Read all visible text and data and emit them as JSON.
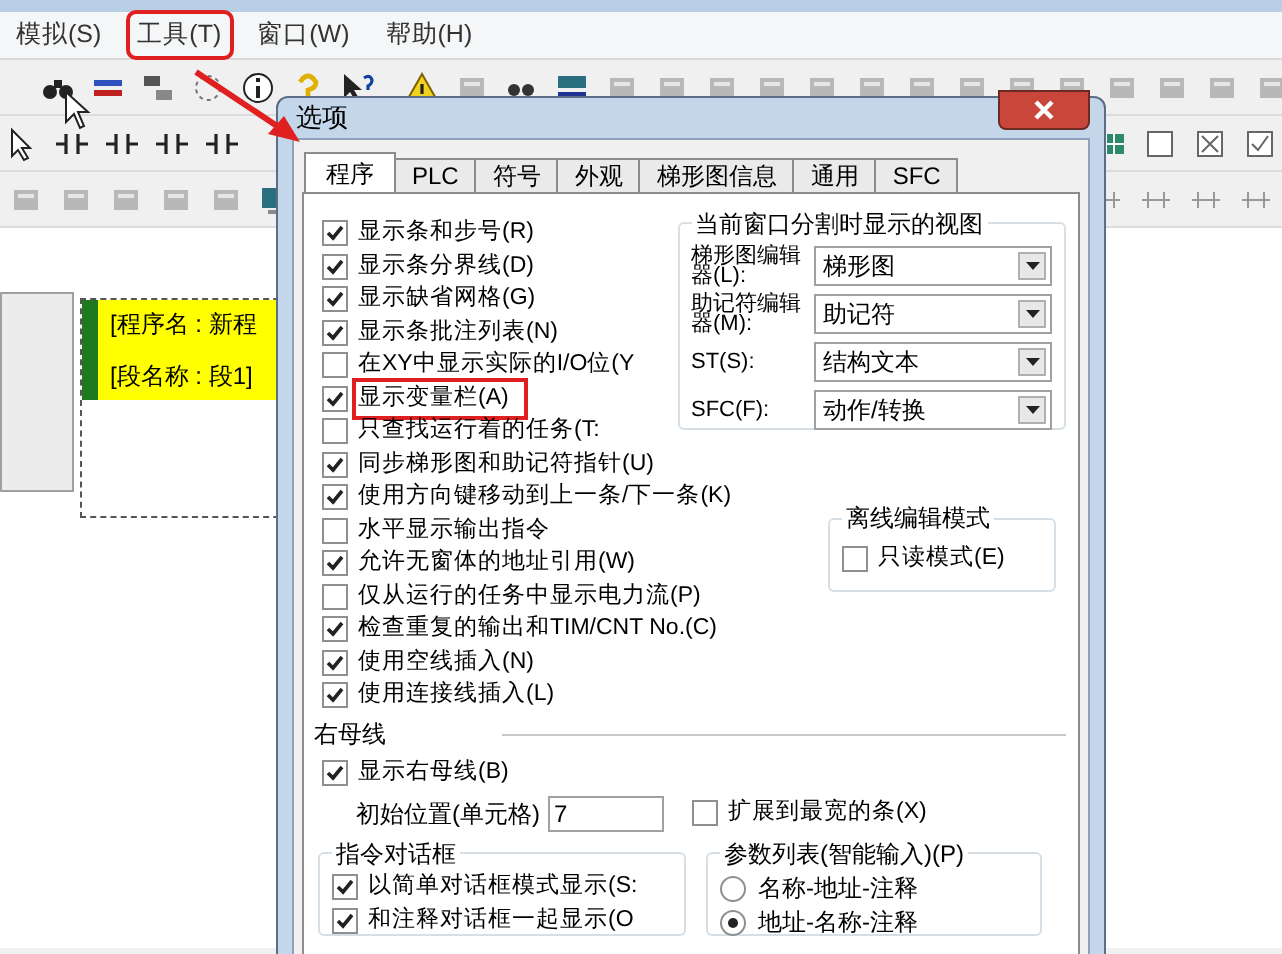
{
  "menu": [
    {
      "label": "模拟(S)",
      "highlighted": false
    },
    {
      "label": "工具(T)",
      "highlighted": true
    },
    {
      "label": "窗口(W)",
      "highlighted": false
    },
    {
      "label": "帮助(H)",
      "highlighted": false
    }
  ],
  "document": {
    "lines": [
      "[程序名 : 新程",
      "[段名称 : 段1]"
    ]
  },
  "dialog": {
    "title": "选项",
    "tabs": [
      {
        "label": "程序",
        "selected": true
      },
      {
        "label": "PLC",
        "selected": false
      },
      {
        "label": "符号",
        "selected": false
      },
      {
        "label": "外观",
        "selected": false
      },
      {
        "label": "梯形图信息",
        "selected": false
      },
      {
        "label": "通用",
        "selected": false
      },
      {
        "label": "SFC",
        "selected": false
      }
    ],
    "options": [
      {
        "label": "显示条和步号(R)",
        "checked": true,
        "highlighted": false
      },
      {
        "label": "显示条分界线(D)",
        "checked": true,
        "highlighted": false
      },
      {
        "label": "显示缺省网格(G)",
        "checked": true,
        "highlighted": false
      },
      {
        "label": "显示条批注列表(N)",
        "checked": true,
        "highlighted": false
      },
      {
        "label": "在XY中显示实际的I/O位(Y",
        "checked": false,
        "highlighted": false
      },
      {
        "label": "显示变量栏(A)",
        "checked": true,
        "highlighted": true
      },
      {
        "label": "只查找运行着的任务(T:",
        "checked": false,
        "highlighted": false
      },
      {
        "label": "同步梯形图和助记符指针(U)",
        "checked": true,
        "highlighted": false
      },
      {
        "label": "使用方向键移动到上一条/下一条(K)",
        "checked": true,
        "highlighted": false
      },
      {
        "label": "水平显示输出指令",
        "checked": false,
        "highlighted": false
      },
      {
        "label": "允许无窗体的地址引用(W)",
        "checked": true,
        "highlighted": false
      },
      {
        "label": "仅从运行的任务中显示电力流(P)",
        "checked": false,
        "highlighted": false
      },
      {
        "label": "检查重复的输出和TIM/CNT No.(C)",
        "checked": true,
        "highlighted": false
      },
      {
        "label": "使用空线插入(N)",
        "checked": true,
        "highlighted": false
      },
      {
        "label": "使用连接线插入(L)",
        "checked": true,
        "highlighted": false
      }
    ],
    "view_group": {
      "title": "当前窗口分割时显示的视图",
      "rows": [
        {
          "label": "梯形图编辑器(L):",
          "value": "梯形图"
        },
        {
          "label": "助记符编辑器(M):",
          "value": "助记符"
        },
        {
          "label": "ST(S):",
          "value": "结构文本"
        },
        {
          "label": "SFC(F):",
          "value": "动作/转换"
        }
      ]
    },
    "offline_group": {
      "title": "离线编辑模式",
      "options": [
        {
          "label": "只读模式(E)",
          "checked": false
        }
      ]
    },
    "right_bus": {
      "title": "右母线",
      "show": {
        "label": "显示右母线(B)",
        "checked": true
      },
      "start_label": "初始位置(单元格)",
      "start_value": "7",
      "extend": {
        "label": "扩展到最宽的条(X)",
        "checked": false
      }
    },
    "instruction_group": {
      "title": "指令对话框",
      "options": [
        {
          "label": "以简单对话框模式显示(S:",
          "checked": true
        },
        {
          "label": "和注释对话框一起显示(O",
          "checked": true
        }
      ]
    },
    "param_group": {
      "title": "参数列表(智能输入)(P)",
      "options": [
        {
          "label": "名称-地址-注释",
          "selected": false
        },
        {
          "label": "地址-名称-注释",
          "selected": true
        }
      ]
    }
  }
}
